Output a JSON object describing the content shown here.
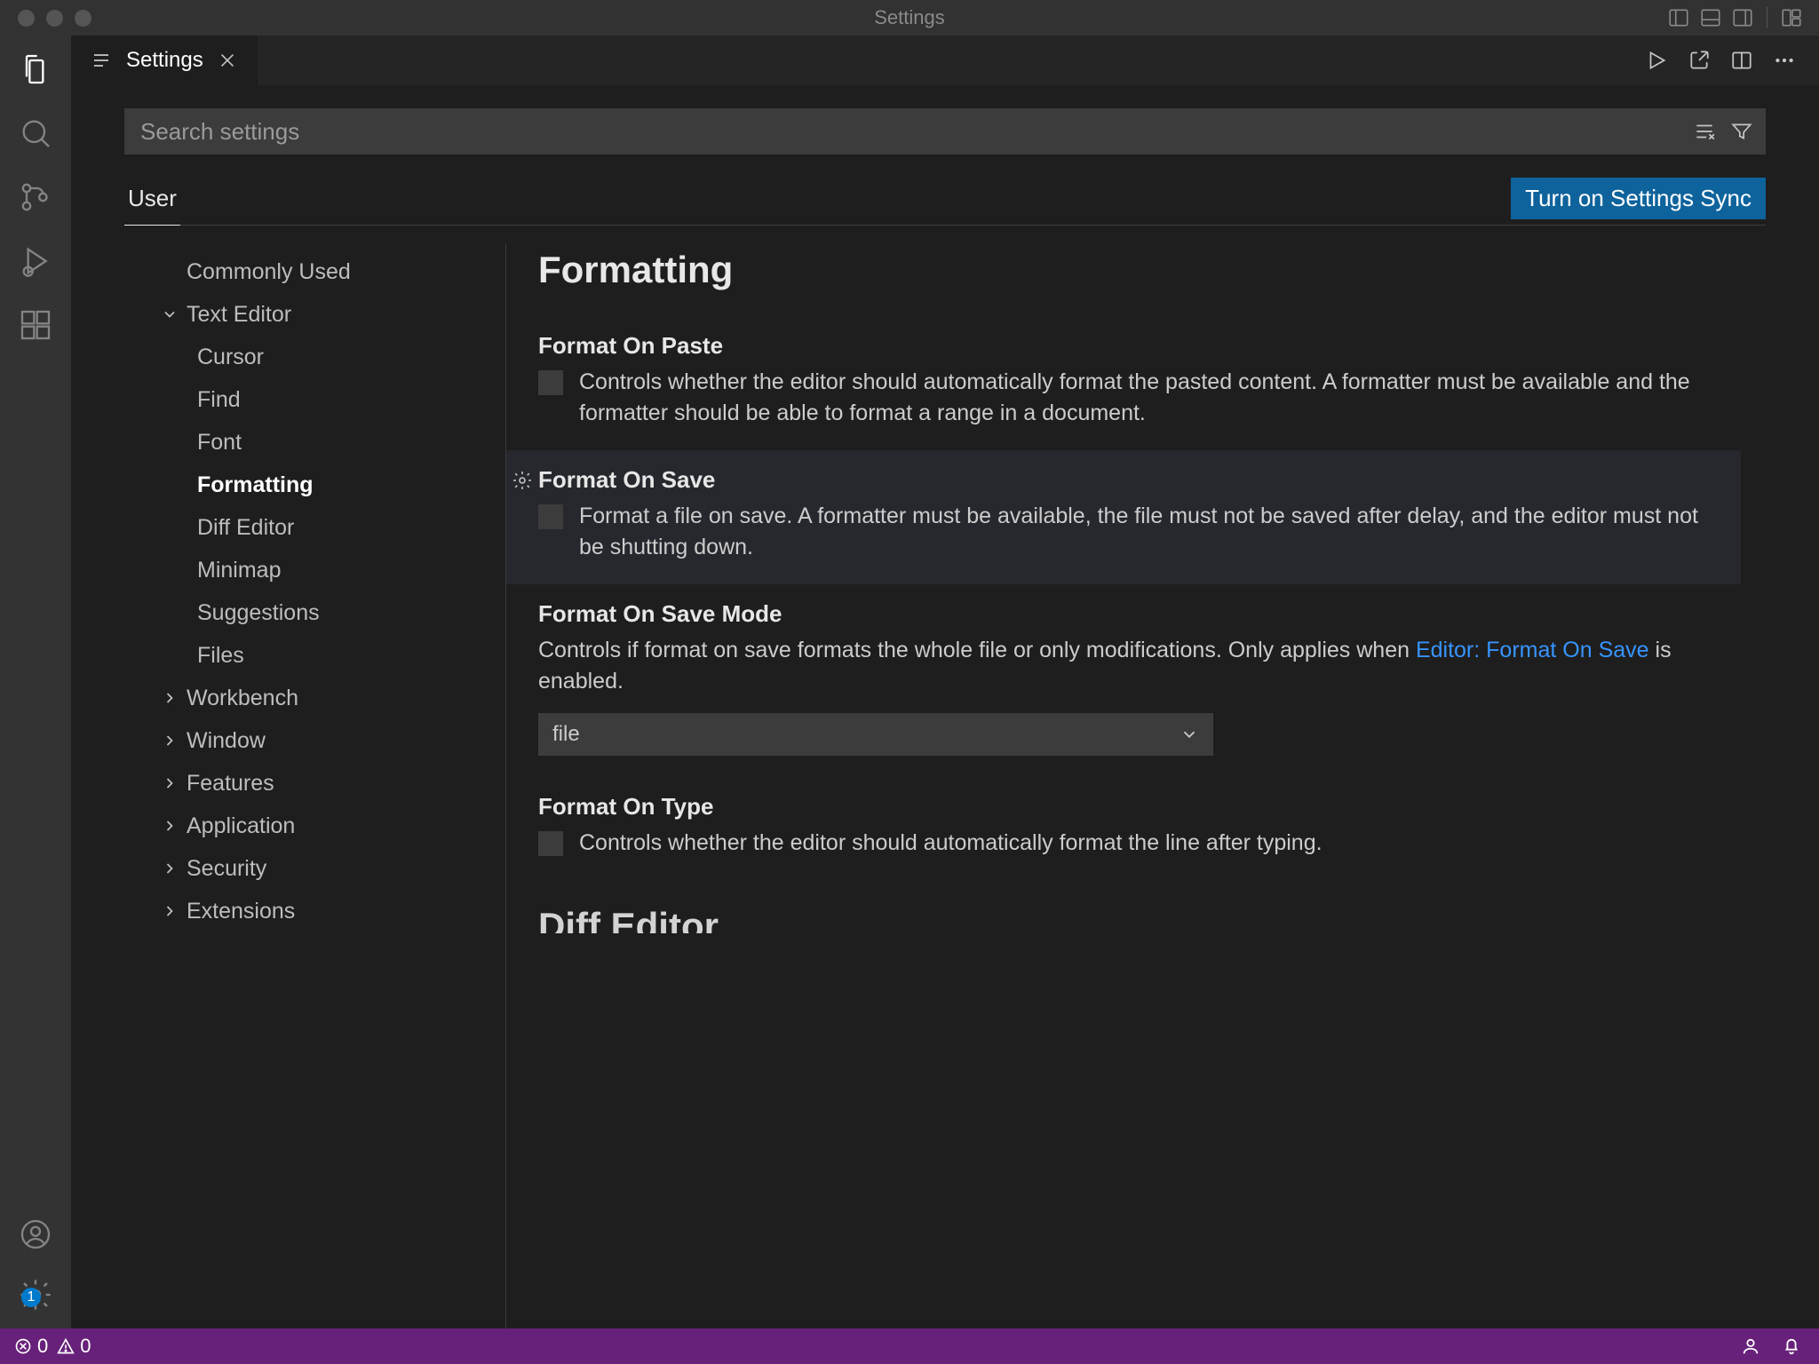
{
  "window": {
    "title": "Settings"
  },
  "tab": {
    "label": "Settings"
  },
  "search": {
    "placeholder": "Search settings"
  },
  "scope": {
    "user": "User"
  },
  "sync": {
    "button": "Turn on Settings Sync"
  },
  "toc": {
    "commonly_used": "Commonly Used",
    "text_editor": "Text Editor",
    "te_children": {
      "cursor": "Cursor",
      "find": "Find",
      "font": "Font",
      "formatting": "Formatting",
      "diff_editor": "Diff Editor",
      "minimap": "Minimap",
      "suggestions": "Suggestions",
      "files": "Files"
    },
    "workbench": "Workbench",
    "window": "Window",
    "features": "Features",
    "application": "Application",
    "security": "Security",
    "extensions": "Extensions"
  },
  "section": {
    "title": "Formatting",
    "next_title": "Diff Editor"
  },
  "settings": {
    "format_on_paste": {
      "title": "Format On Paste",
      "desc": "Controls whether the editor should automatically format the pasted content. A formatter must be available and the formatter should be able to format a range in a document."
    },
    "format_on_save": {
      "title": "Format On Save",
      "desc": "Format a file on save. A formatter must be available, the file must not be saved after delay, and the editor must not be shutting down."
    },
    "format_on_save_mode": {
      "title": "Format On Save Mode",
      "desc_pre": "Controls if format on save formats the whole file or only modifications. Only applies when ",
      "desc_link": "Editor: Format On Save",
      "desc_post": " is enabled.",
      "value": "file"
    },
    "format_on_type": {
      "title": "Format On Type",
      "desc": "Controls whether the editor should automatically format the line after typing."
    }
  },
  "status": {
    "errors": "0",
    "warnings": "0"
  },
  "activity": {
    "gear_badge": "1"
  }
}
